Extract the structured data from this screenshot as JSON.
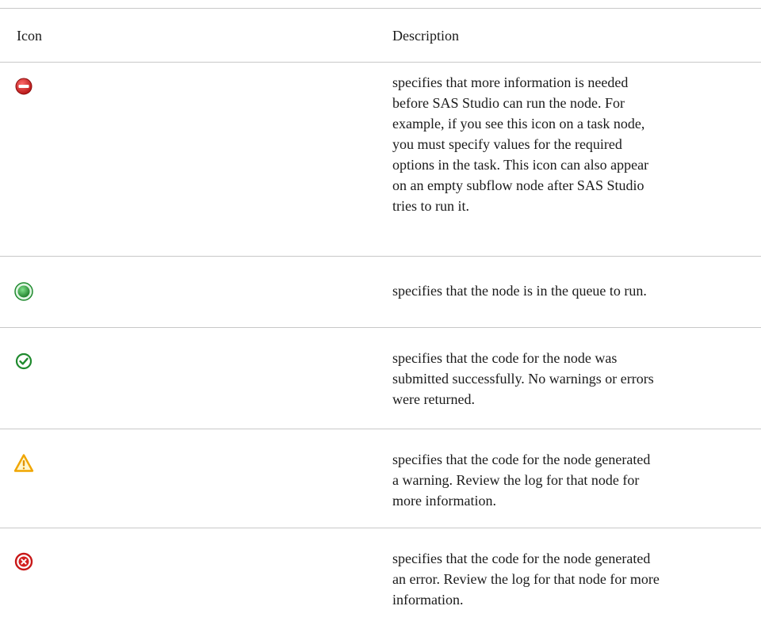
{
  "table": {
    "headers": {
      "icon": "Icon",
      "description": "Description"
    },
    "rows": [
      {
        "icon": "required-info-missing-icon",
        "description": "specifies that more information is needed\nbefore SAS Studio can run the node. For\nexample, if you see this icon on a task node,\nyou must specify values for the required\noptions in the task. This icon can also appear\non an empty subflow node after SAS Studio\ntries to run it."
      },
      {
        "icon": "queued-icon",
        "description": "specifies that the node is in the queue to run."
      },
      {
        "icon": "success-check-icon",
        "description": "specifies that the code for the node was\nsubmitted successfully. No warnings or errors\nwere returned."
      },
      {
        "icon": "warning-icon",
        "description": "specifies that the code for the node generated\na warning. Review the log for that node for\nmore information."
      },
      {
        "icon": "error-icon",
        "description": "specifies that the code for the node generated\nan error. Review the log for that node for more\ninformation."
      }
    ]
  },
  "colors": {
    "red": "#d42020",
    "green": "#1f8a2e",
    "amber": "#f0a500",
    "rule": "#c8c8c8"
  }
}
